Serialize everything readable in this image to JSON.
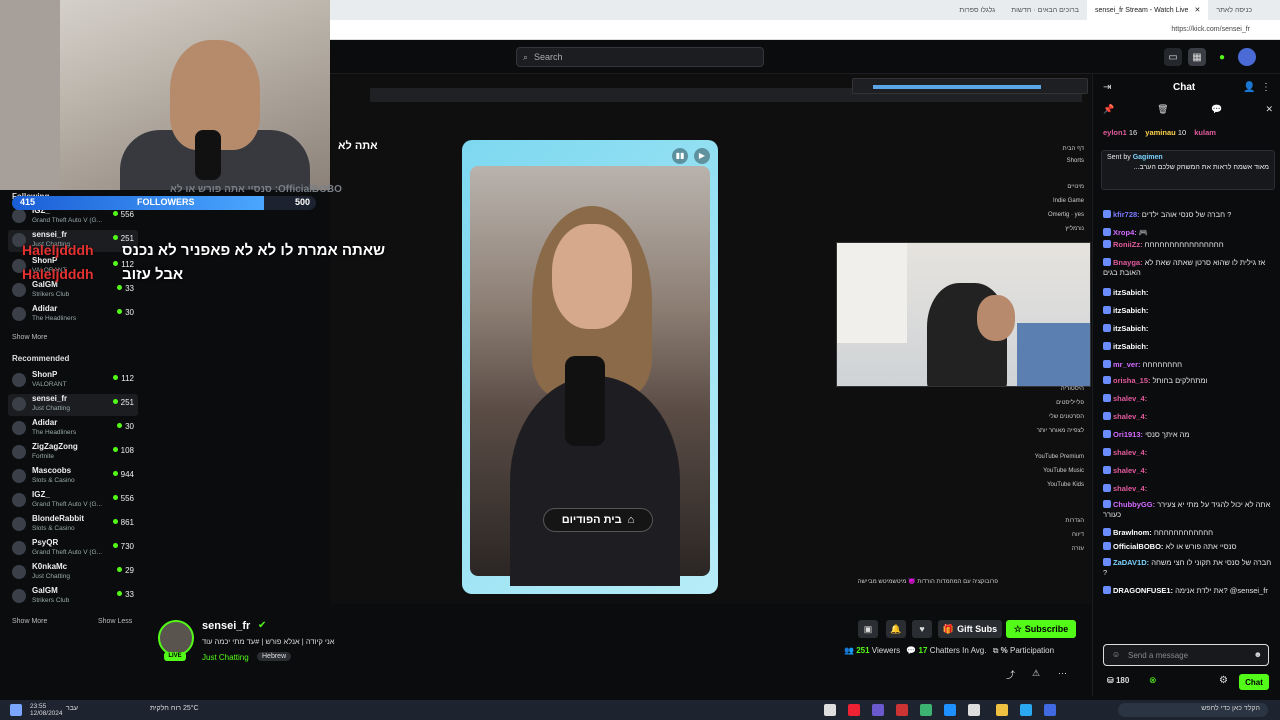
{
  "browser": {
    "tabs": [
      {
        "label": "כניסה לאתר"
      },
      {
        "label": "ברוכים הבאים · חדשות"
      },
      {
        "label": "sensei_fr Stream - Watch Live"
      },
      {
        "label": "גלגלו ספרות"
      }
    ],
    "url": "https://kick.com/sensei_fr"
  },
  "header": {
    "search_placeholder": "Search"
  },
  "overlay": {
    "followers_current": "415",
    "followers_label": "FOLLOWERS",
    "followers_goal": "500",
    "followers_fraction": 0.83,
    "tts_lines": [
      {
        "user": "Haleljdddh",
        "text": "שאתה אמרת לו לא לא פאפניר לא נכנס"
      },
      {
        "user": "Haleljdddh",
        "text": "אבל עזוב"
      }
    ],
    "top_text": "אתה לא",
    "official_line": "OfficialBOBO: סנסיי אתה פורש או לא"
  },
  "sidebar": {
    "following_label": "Following",
    "following": [
      {
        "name": "IGZ_",
        "category": "Grand Theft Auto V (G...",
        "count": "556"
      },
      {
        "name": "sensei_fr",
        "category": "Just Chatting",
        "count": "251"
      },
      {
        "name": "ShonP",
        "category": "VALORANT",
        "count": "112"
      },
      {
        "name": "GalGM",
        "category": "Strikers Club",
        "count": "33"
      },
      {
        "name": "Adidar",
        "category": "The Headliners",
        "count": "30"
      }
    ],
    "show_more": "Show More",
    "recommended_label": "Recommended",
    "recommended": [
      {
        "name": "ShonP",
        "category": "VALORANT",
        "count": "112"
      },
      {
        "name": "sensei_fr",
        "category": "Just Chatting",
        "count": "251"
      },
      {
        "name": "Adidar",
        "category": "The Headliners",
        "count": "30"
      },
      {
        "name": "ZigZagZong",
        "category": "Fortnite",
        "count": "108"
      },
      {
        "name": "Mascoobs",
        "category": "Slots & Casino",
        "count": "944"
      },
      {
        "name": "IGZ_",
        "category": "Grand Theft Auto V (G...",
        "count": "556"
      },
      {
        "name": "BlondeRabbit",
        "category": "Slots & Casino",
        "count": "861"
      },
      {
        "name": "PsyQR",
        "category": "Grand Theft Auto V (G...",
        "count": "730"
      },
      {
        "name": "K0nkaMc",
        "category": "Just Chatting",
        "count": "29"
      },
      {
        "name": "GalGM",
        "category": "Strikers Club",
        "count": "33"
      }
    ],
    "show_more_2": "Show More",
    "show_less": "Show Less"
  },
  "stream": {
    "caption": "בית הפודיום",
    "yt_menu": [
      "דף הבית",
      "Shorts",
      "מינויים",
      "Indie Game",
      "Omertig · yes",
      "נורמליץ",
      "היסטוריה",
      "פלייליסטים",
      "הסרטונים שלי",
      "לצפייה מאוחר יותר",
      "YouTube Premium",
      "YouTube Music",
      "YouTube Kids",
      "הגדרות",
      "דיווח",
      "עזרה"
    ],
    "yt_footer": "פרובוקציה עם המחמדות הורדות 😈 מיטשמיטש מביישה"
  },
  "channel": {
    "name": "sensei_fr",
    "title": "אני קיודה | אנלא פורש | #עד מתי יכמה עוד",
    "category": "Just Chatting",
    "tag": "Hebrew",
    "live": "LIVE",
    "gift_label": "Gift Subs",
    "subscribe_label": "Subscribe",
    "viewers": "251",
    "viewers_label": "Viewers",
    "chatters": "17",
    "chatters_label": "Chatters In Avg.",
    "participation": "%",
    "participation_label": "Participation"
  },
  "chat": {
    "title": "Chat",
    "pinned_top": [
      {
        "user": "eylon1",
        "count": "16"
      },
      {
        "user": "yaminau",
        "count": "10"
      },
      {
        "user": "kulam",
        "count": ""
      }
    ],
    "pinned_sender": "Gagimen",
    "pinned_text": "מאוד אשמח לראות את המשחק שלכם הערב...",
    "pinned_prefix": "Sent by",
    "messages": [
      {
        "user": "kfir728",
        "color": "#7b7bff",
        "text": "חברה של סנסי אוהב ילדים ?"
      },
      {
        "user": "Xrop4",
        "color": "#d36bff",
        "text": "🎮"
      },
      {
        "user": "RoniiZz",
        "color": "#e35b9d",
        "text": "חחחחחחחחחחחחחחחח"
      },
      {
        "user": "Bnayga",
        "color": "#e35b9d",
        "text": "אז גילית לו שהוא סרטן שאתה שאת לא האובת בגים"
      },
      {
        "user": "itzSabich",
        "color": "#ffffff",
        "text": ""
      },
      {
        "user": "itzSabich",
        "color": "#ffffff",
        "text": ""
      },
      {
        "user": "itzSabich",
        "color": "#ffffff",
        "text": ""
      },
      {
        "user": "itzSabich",
        "color": "#ffffff",
        "text": ""
      },
      {
        "user": "mr_ver",
        "color": "#d36bff",
        "text": "חחחחחחחח"
      },
      {
        "user": "orisha_15",
        "color": "#e35b9d",
        "text": "ומתחלקים בחותל"
      },
      {
        "user": "shalev_4",
        "color": "#e35b9d",
        "text": ""
      },
      {
        "user": "shalev_4",
        "color": "#e35b9d",
        "text": ""
      },
      {
        "user": "Ori1913",
        "color": "#d36bff",
        "text": "מה איתך סנסי"
      },
      {
        "user": "shalev_4",
        "color": "#e35b9d",
        "text": ""
      },
      {
        "user": "shalev_4",
        "color": "#e35b9d",
        "text": ""
      },
      {
        "user": "shalev_4",
        "color": "#e35b9d",
        "text": ""
      },
      {
        "user": "ChubbyGG",
        "color": "#d36bff",
        "text": "אתה לא יכול להגיד על מתי יא צעירר כעורר"
      },
      {
        "user": "Brawlnom",
        "color": "#ffffff",
        "text": "חחחחחחחחחחחח"
      },
      {
        "user": "OfficialBOBO",
        "color": "#ffffff",
        "text": "סנסיי אתה פורש או לא"
      },
      {
        "user": "ZaDAV1D",
        "color": "#7bd3ff",
        "text": "חברה של סנסי את תקוני לו חצי משחה ?"
      },
      {
        "user": "DRAGONFUSE1",
        "color": "#ffffff",
        "text": "את ילדת אנימה? @sensei_fr"
      }
    ],
    "input_placeholder": "Send a message",
    "points": "180",
    "send_label": "Chat"
  },
  "taskbar": {
    "time": "23:55",
    "date": "12/08/2024",
    "weather": "25°C רוח חלקית",
    "lang": "עבר",
    "search_text": "הקלד כאן כדי לחפש"
  },
  "colors": {
    "kick_green": "#53fc18",
    "follow_bar": "#1a5ed6",
    "tts_name": "#e43232"
  }
}
